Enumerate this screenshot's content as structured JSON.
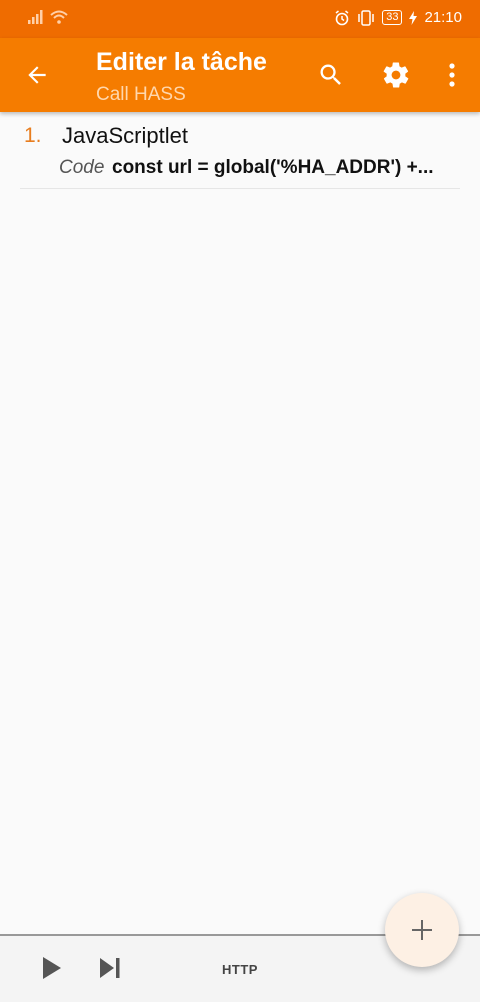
{
  "status_bar": {
    "time": "21:10",
    "battery": "33",
    "icons": [
      "signal-icon",
      "wifi-icon",
      "alarm-icon",
      "vibrate-icon",
      "battery-icon",
      "charging-icon"
    ]
  },
  "app_bar": {
    "title": "Editer la tâche",
    "subtitle": "Call HASS",
    "icons": [
      "back-arrow-icon",
      "search-icon",
      "settings-gear-icon",
      "more-vert-icon"
    ]
  },
  "actions": [
    {
      "number": "1.",
      "name": "JavaScriptlet",
      "param_label": "Code",
      "param_value": "const url = global('%HA_ADDR') +..."
    }
  ],
  "bottom_bar": {
    "http_label": "HTTP",
    "icons": [
      "play-icon",
      "skip-next-icon"
    ]
  },
  "fab": {
    "icon": "plus-icon"
  },
  "colors": {
    "status_bar": "#ef6c00",
    "app_bar": "#f57c00",
    "accent": "#e87d1e",
    "background": "#fafafa"
  }
}
